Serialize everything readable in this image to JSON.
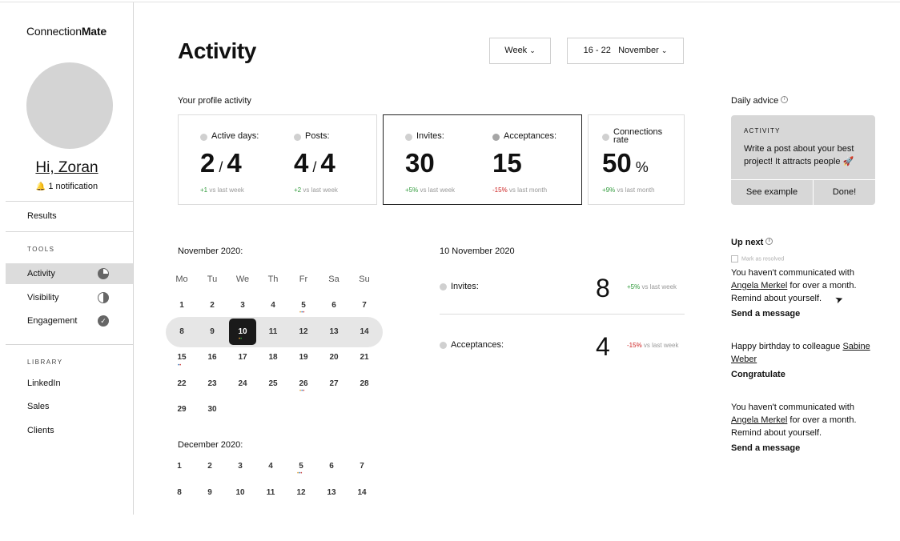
{
  "app": {
    "logo_light": "Connection",
    "logo_bold": "Mate"
  },
  "sidebar": {
    "greeting": "Hi, Zoran",
    "notification": "1 notification",
    "results": "Results",
    "tools_heading": "TOOLS",
    "tools": [
      {
        "label": "Activity",
        "icon": "pie-chart-icon",
        "active": true
      },
      {
        "label": "Visibility",
        "icon": "half-circle-icon",
        "active": false
      },
      {
        "label": "Engagement",
        "icon": "check-circle-icon",
        "active": false
      }
    ],
    "library_heading": "LIBRARY",
    "library": [
      "LinkedIn",
      "Sales",
      "Clients"
    ]
  },
  "header": {
    "title": "Activity",
    "period_select": "Week",
    "date_range": "16 - 22",
    "month_select": "November"
  },
  "profile_activity": {
    "heading": "Your profile activity",
    "stats": [
      {
        "label": "Active days:",
        "value": "2",
        "total": "4",
        "delta": "+1",
        "vs": "vs last  week"
      },
      {
        "label": "Posts:",
        "value": "4",
        "total": "4",
        "delta": "+2",
        "vs": "vs last  week"
      },
      {
        "label": "Invites:",
        "value": "30",
        "delta": "+5%",
        "vs": "vs last week"
      },
      {
        "label": "Acceptances:",
        "value": "15",
        "delta": "-15%",
        "vs": "vs last month"
      },
      {
        "label": "Connections rate",
        "value": "50",
        "unit": "%",
        "delta": "+9%",
        "vs": "vs last month"
      }
    ]
  },
  "advice": {
    "heading": "Daily advice",
    "kicker": "ACTIVITY",
    "text": "Write a post about your best project! It attracts people 🚀",
    "see_example": "See example",
    "done": "Done!"
  },
  "calendar": {
    "november_title": "November 2020:",
    "december_title": "December 2020:",
    "weekdays": [
      "Mo",
      "Tu",
      "We",
      "Th",
      "Fr",
      "Sa",
      "Su"
    ],
    "november_weeks": [
      [
        "1",
        "2",
        "3",
        "4",
        "5",
        "6",
        "7"
      ],
      [
        "8",
        "9",
        "10",
        "11",
        "12",
        "13",
        "14"
      ],
      [
        "15",
        "16",
        "17",
        "18",
        "19",
        "20",
        "21"
      ],
      [
        "22",
        "23",
        "24",
        "25",
        "26",
        "27",
        "28"
      ],
      [
        "29",
        "30"
      ]
    ],
    "december_weeks": [
      [
        "1",
        "2",
        "3",
        "4",
        "5",
        "6",
        "7"
      ],
      [
        "8",
        "9",
        "10",
        "11",
        "12",
        "13",
        "14"
      ]
    ],
    "selected_day": "10"
  },
  "day_detail": {
    "date": "10 November 2020",
    "rows": [
      {
        "label": "Invites:",
        "value": "8",
        "delta": "+5%",
        "vs": "vs last week"
      },
      {
        "label": "Acceptances:",
        "value": "4",
        "delta": "-15%",
        "vs": "vs last week"
      }
    ]
  },
  "up_next": {
    "heading": "Up next",
    "mark_resolved": "Mark as resolved",
    "items": [
      {
        "pre": "You haven't communicated with",
        "link": "Angela Merkel",
        "post": "for over a month. Remind about yourself.",
        "action": "Send a message"
      },
      {
        "pre": "Happy birthday to colleague",
        "link": "Sabine Weber",
        "post": "",
        "action": "Congratulate"
      },
      {
        "pre": "You haven't communicated with",
        "link": "Angela Merkel",
        "post": "for over a month. Remind about yourself.",
        "action": "Send a message"
      }
    ]
  },
  "colors": {
    "positive": "#2f9a3a",
    "negative": "#cc2222",
    "selected_day": "#1a1a1a"
  }
}
